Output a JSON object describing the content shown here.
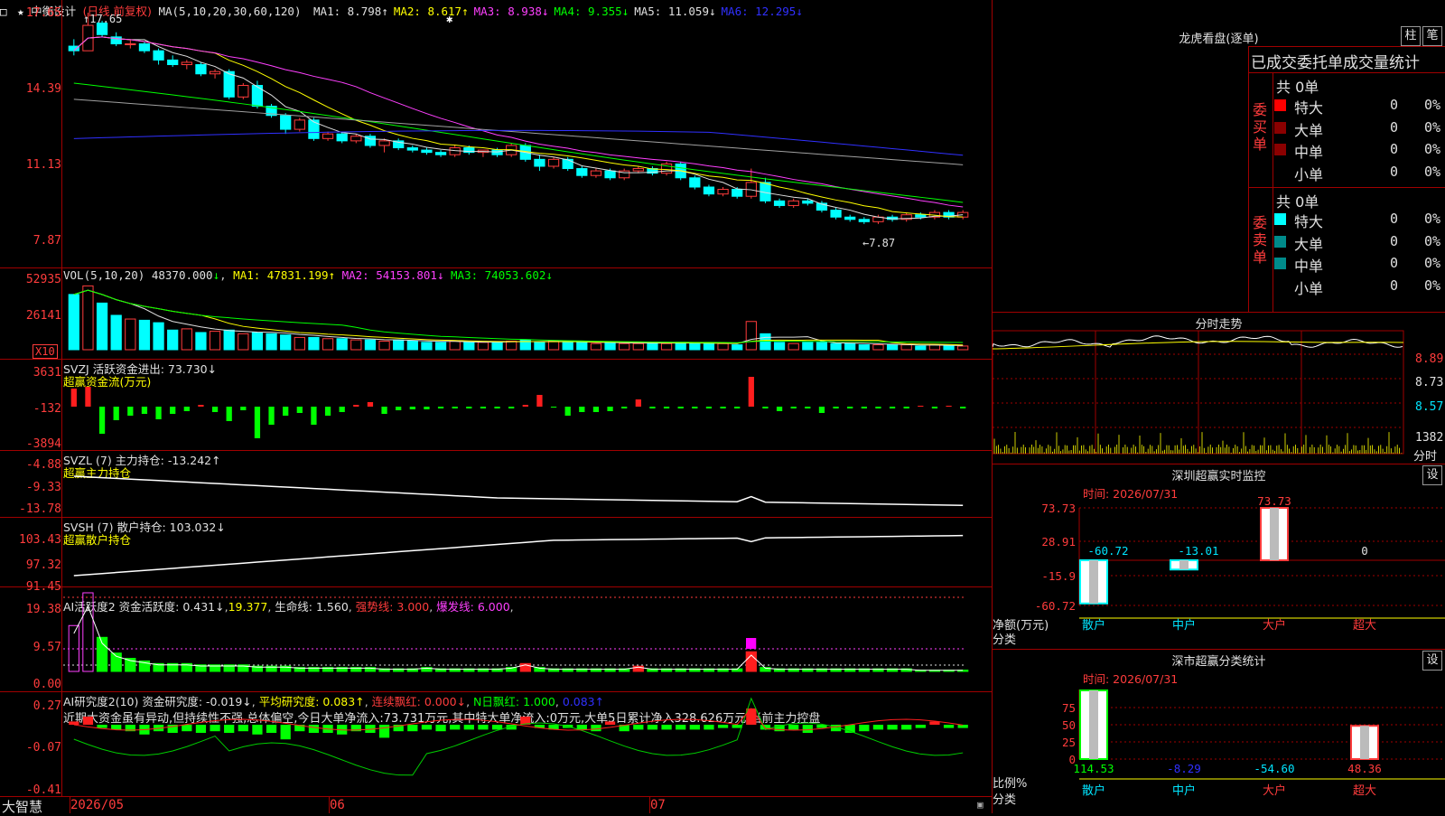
{
  "main": {
    "stock_name": "中衡设计",
    "period": "(日线,前复权)",
    "ma_label": "MA(5,10,20,30,60,120)",
    "ma": [
      {
        "name": "MA1",
        "val": "8.798",
        "dir": "↑",
        "color": "#e0e0e0"
      },
      {
        "name": "MA2",
        "val": "8.617",
        "dir": "↑",
        "color": "#ffff00"
      },
      {
        "name": "MA3",
        "val": "8.938",
        "dir": "↓",
        "color": "#ff40ff"
      },
      {
        "name": "MA4",
        "val": "9.355",
        "dir": "↓",
        "color": "#00ff00"
      },
      {
        "name": "MA5",
        "val": "11.059",
        "dir": "↓",
        "color": "#e0e0e0"
      },
      {
        "name": "MA6",
        "val": "12.295",
        "dir": "↓",
        "color": "#3030ff"
      }
    ],
    "y_labels": [
      "17.65",
      "14.39",
      "11.13",
      "7.87"
    ],
    "high_mark": "17.65",
    "low_mark": "7.87"
  },
  "vol": {
    "label": "VOL(5,10,20)",
    "value": "48370.000",
    "dir": "↓",
    "ma1": "MA1: 47831.199↑",
    "ma2": "MA2: 54153.801↓",
    "ma3": "MA3: 74053.602↓",
    "y_labels": [
      "52935",
      "26141"
    ],
    "unit": "X10"
  },
  "svzj": {
    "label": "SVZJ  活跃资金进出: 73.730↓",
    "sub": "超赢资金流(万元)",
    "y_labels": [
      "3631",
      "-132",
      "-3894"
    ]
  },
  "svzl": {
    "label": "SVZL (7) 主力持仓: -13.242↑",
    "sub": "超赢主力持仓",
    "y_labels": [
      "-4.88",
      "-9.33",
      "-13.78"
    ]
  },
  "svsh": {
    "label": "SVSH (7) 散户持仓: 103.032↓",
    "sub": "超赢散户持仓",
    "y_labels": [
      "103.43",
      "97.32",
      "91.45"
    ]
  },
  "ai_active": {
    "label": "AI活跃度2 资金活跃度: 0.431↓",
    "v2": "19.377",
    "life": "生命线: 1.560",
    "strong": "强势线: 3.000",
    "burst": "爆发线: 6.000",
    "y_labels": [
      "19.38",
      "9.57",
      "0.00"
    ]
  },
  "ai_research": {
    "label": "AI研究度2(10) 资金研究度: -0.019↓",
    "avg": "平均研究度: 0.083↑",
    "cont": "连续飘红: 0.000↓",
    "nday": "N日飘红: 1.000",
    "extra": "0.083↑",
    "comment": "近期大资金虽有异动,但持续性不强,总体偏空,今日大单净流入:73.731万元,其中特大单净流入:0万元,大单5日累计净入328.626万元,当前主力控盘",
    "y_labels": [
      "0.27",
      "-0.07",
      "-0.41"
    ]
  },
  "time_axis": {
    "brand": "大智慧",
    "labels": [
      "2026/05",
      "06",
      "07"
    ]
  },
  "longhu": {
    "title": "龙虎看盘(逐单)",
    "btn1": "柱",
    "btn2": "笔",
    "header": "已成交委托单成交量统计",
    "buy_label": "委买单",
    "sell_label": "委卖单",
    "buy_total": "共 0单",
    "sell_total": "共 0单",
    "rows": [
      "特大",
      "大单",
      "中单",
      "小单"
    ],
    "buy_colors": [
      "#ff0000",
      "#8b0000",
      "#8b0000",
      ""
    ],
    "sell_colors": [
      "#00ffff",
      "#008b8b",
      "#008b8b",
      ""
    ],
    "count": "0",
    "pct": "0%"
  },
  "fenshi": {
    "title": "分时走势",
    "y_labels": [
      "8.89",
      "8.73",
      "8.57"
    ],
    "vol_label": "1382",
    "unit": "分时"
  },
  "sz_monitor": {
    "title": "深圳超赢实时监控",
    "btn": "设",
    "time": "时间: 2026/07/31",
    "y_labels": [
      "73.73",
      "28.91",
      "-15.9",
      "-60.72"
    ],
    "values": [
      "-60.72",
      "-13.01",
      "73.73",
      "0"
    ],
    "unit1": "净额(万元)",
    "unit2": "分类",
    "cats": [
      "散户",
      "中户",
      "大户",
      "超大"
    ]
  },
  "sz_stats": {
    "title": "深市超赢分类统计",
    "btn": "设",
    "time": "时间: 2026/07/31",
    "y_labels": [
      "75",
      "50",
      "25",
      "0"
    ],
    "values": [
      "114.53",
      "-8.29",
      "-54.60",
      "48.36"
    ],
    "unit1": "比例%",
    "unit2": "分类",
    "cats": [
      "散户",
      "中户",
      "大户",
      "超大"
    ]
  },
  "chart_data": {
    "type": "candlestick",
    "y_axis": [
      7.87,
      17.65
    ],
    "x_labels": [
      "2026/05",
      "06",
      "07"
    ],
    "ohlc": [
      [
        16.2,
        16.5,
        15.8,
        16.0
      ],
      [
        16.0,
        17.65,
        16.0,
        17.1
      ],
      [
        17.2,
        17.3,
        16.6,
        16.7
      ],
      [
        16.6,
        16.8,
        16.2,
        16.3
      ],
      [
        16.3,
        16.5,
        16.1,
        16.3
      ],
      [
        16.3,
        16.4,
        15.9,
        16.0
      ],
      [
        16.0,
        16.1,
        15.4,
        15.6
      ],
      [
        15.6,
        15.8,
        15.3,
        15.4
      ],
      [
        15.4,
        15.6,
        15.2,
        15.5
      ],
      [
        15.4,
        15.5,
        14.9,
        15.0
      ],
      [
        15.0,
        15.2,
        14.8,
        15.1
      ],
      [
        15.1,
        15.2,
        13.9,
        14.0
      ],
      [
        14.0,
        14.6,
        13.9,
        14.5
      ],
      [
        14.5,
        14.7,
        13.5,
        13.6
      ],
      [
        13.6,
        13.7,
        13.1,
        13.2
      ],
      [
        13.2,
        13.3,
        12.4,
        12.6
      ],
      [
        12.6,
        13.1,
        12.5,
        13.0
      ],
      [
        13.0,
        13.1,
        12.1,
        12.2
      ],
      [
        12.2,
        12.5,
        12.1,
        12.4
      ],
      [
        12.4,
        12.5,
        12.0,
        12.1
      ],
      [
        12.1,
        12.4,
        12.0,
        12.3
      ],
      [
        12.3,
        12.4,
        11.8,
        11.9
      ],
      [
        11.9,
        12.2,
        11.6,
        12.1
      ],
      [
        12.1,
        12.2,
        11.7,
        11.8
      ],
      [
        11.8,
        11.9,
        11.6,
        11.7
      ],
      [
        11.7,
        11.8,
        11.5,
        11.6
      ],
      [
        11.6,
        11.7,
        11.4,
        11.5
      ],
      [
        11.5,
        11.9,
        11.4,
        11.8
      ],
      [
        11.8,
        11.9,
        11.5,
        11.6
      ],
      [
        11.6,
        11.7,
        11.4,
        11.7
      ],
      [
        11.7,
        11.8,
        11.4,
        11.5
      ],
      [
        11.5,
        12.0,
        11.4,
        11.9
      ],
      [
        11.9,
        12.0,
        11.2,
        11.3
      ],
      [
        11.3,
        11.5,
        10.8,
        11.0
      ],
      [
        11.0,
        11.4,
        10.9,
        11.3
      ],
      [
        11.3,
        11.4,
        10.8,
        10.9
      ],
      [
        10.9,
        11.0,
        10.5,
        10.6
      ],
      [
        10.6,
        10.9,
        10.5,
        10.8
      ],
      [
        10.8,
        10.9,
        10.4,
        10.5
      ],
      [
        10.5,
        10.9,
        10.4,
        10.8
      ],
      [
        10.8,
        11.0,
        10.7,
        10.9
      ],
      [
        10.9,
        11.0,
        10.6,
        10.7
      ],
      [
        10.7,
        11.2,
        10.6,
        11.1
      ],
      [
        11.1,
        11.2,
        10.4,
        10.5
      ],
      [
        10.5,
        10.6,
        10.0,
        10.1
      ],
      [
        10.1,
        10.2,
        9.7,
        9.8
      ],
      [
        9.8,
        10.1,
        9.7,
        10.0
      ],
      [
        10.0,
        10.1,
        9.6,
        9.7
      ],
      [
        9.7,
        10.9,
        9.6,
        10.3
      ],
      [
        10.3,
        10.5,
        9.4,
        9.5
      ],
      [
        9.5,
        9.6,
        9.2,
        9.3
      ],
      [
        9.3,
        9.6,
        9.2,
        9.5
      ],
      [
        9.5,
        9.6,
        9.3,
        9.4
      ],
      [
        9.4,
        9.5,
        9.0,
        9.1
      ],
      [
        9.1,
        9.2,
        8.7,
        8.8
      ],
      [
        8.8,
        8.9,
        8.6,
        8.7
      ],
      [
        8.7,
        8.8,
        8.5,
        8.6
      ],
      [
        8.6,
        8.9,
        8.5,
        8.8
      ],
      [
        8.8,
        8.9,
        8.6,
        8.7
      ],
      [
        8.7,
        9.0,
        8.6,
        8.9
      ],
      [
        8.9,
        9.0,
        8.7,
        8.8
      ],
      [
        8.8,
        9.1,
        8.7,
        9.0
      ],
      [
        9.0,
        9.1,
        8.7,
        8.8
      ],
      [
        8.8,
        9.1,
        8.7,
        9.0
      ]
    ]
  }
}
